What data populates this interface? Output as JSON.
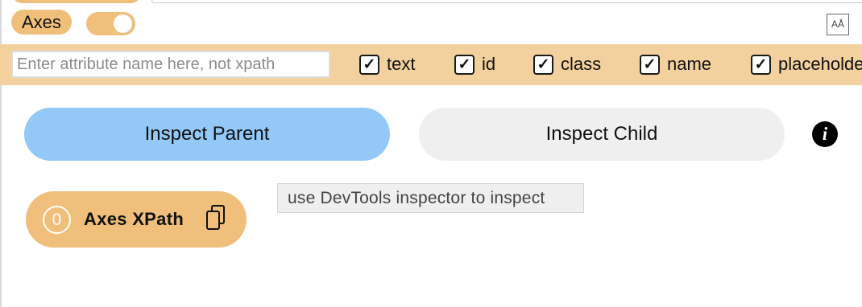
{
  "header": {
    "axes_badge": "Axes",
    "axes_toggle_on": true,
    "font_icon_glyph": "AÅ"
  },
  "attributes": {
    "input_placeholder": "Enter attribute name here, not xpath",
    "checkboxes": [
      {
        "label": "text",
        "checked": true
      },
      {
        "label": "id",
        "checked": true
      },
      {
        "label": "class",
        "checked": true
      },
      {
        "label": "name",
        "checked": true
      },
      {
        "label": "placeholde",
        "checked": true
      }
    ]
  },
  "actions": {
    "inspect_parent": "Inspect Parent",
    "inspect_child": "Inspect Child",
    "info_glyph": "i"
  },
  "tooltip": "use DevTools inspector to inspect",
  "result": {
    "count": "0",
    "label": "Axes XPath"
  },
  "colors": {
    "accent_orange": "#efbf7b",
    "attr_bar": "#f2d19f",
    "parent_button": "#93c8f7",
    "child_button": "#efefef"
  }
}
